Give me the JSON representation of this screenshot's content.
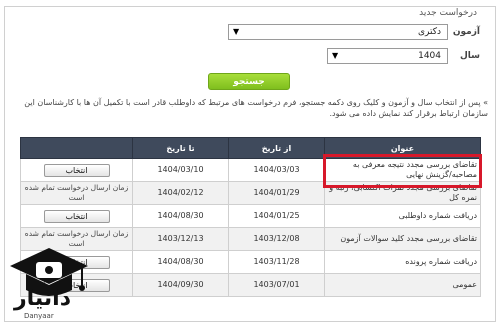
{
  "form": {
    "legend": "درخواست جدید",
    "exam_label": "آزمون",
    "exam_value": "دکتری",
    "year_label": "سال",
    "year_value": "1404",
    "search_label": "جستجو",
    "info_text": "» پس از انتخاب سال و آزمون و کلیک روی دکمه جستجو، فرم درخواست های مرتبط که داوطلب قادر است با تکمیل آن ها با کارشناسان این سازمان ارتباط برقرار کند نمایش داده می شود."
  },
  "table": {
    "headers": {
      "title": "عنوان",
      "from_date": "از تاریخ",
      "to_date": "تا تاریخ",
      "action": ""
    },
    "rows": [
      {
        "title": "تقاضای بررسی مجدد نتیجه معرفی به مصاحبه/گزینش نهایی",
        "from_date": "1404/03/03",
        "to_date": "1404/03/10",
        "action": "انتخاب",
        "action_type": "button"
      },
      {
        "title": "تقاضای بررسی مجدد نمرات اکتسابی، رتبه و نمره کل",
        "from_date": "1404/01/29",
        "to_date": "1404/02/12",
        "action": "زمان ارسال درخواست تمام شده است",
        "action_type": "text"
      },
      {
        "title": "دریافت شماره داوطلبی",
        "from_date": "1404/01/25",
        "to_date": "1404/08/30",
        "action": "انتخاب",
        "action_type": "button"
      },
      {
        "title": "تقاضای بررسی مجدد کلید سوالات آزمون",
        "from_date": "1403/12/08",
        "to_date": "1403/12/13",
        "action": "زمان ارسال درخواست تمام شده است",
        "action_type": "text"
      },
      {
        "title": "دریافت شماره پرونده",
        "from_date": "1403/11/28",
        "to_date": "1404/08/30",
        "action": "انتخاب",
        "action_type": "button"
      },
      {
        "title": "عمومی",
        "from_date": "1403/07/01",
        "to_date": "1404/09/30",
        "action": "انتخاب",
        "action_type": "button"
      }
    ]
  },
  "watermark": {
    "logo_text": "دانیار",
    "logo_sub": "Danyaar"
  },
  "colors": {
    "header_bg": "#3f4a5c",
    "search_button": "#8cc42a",
    "highlight": "#d7182a"
  }
}
